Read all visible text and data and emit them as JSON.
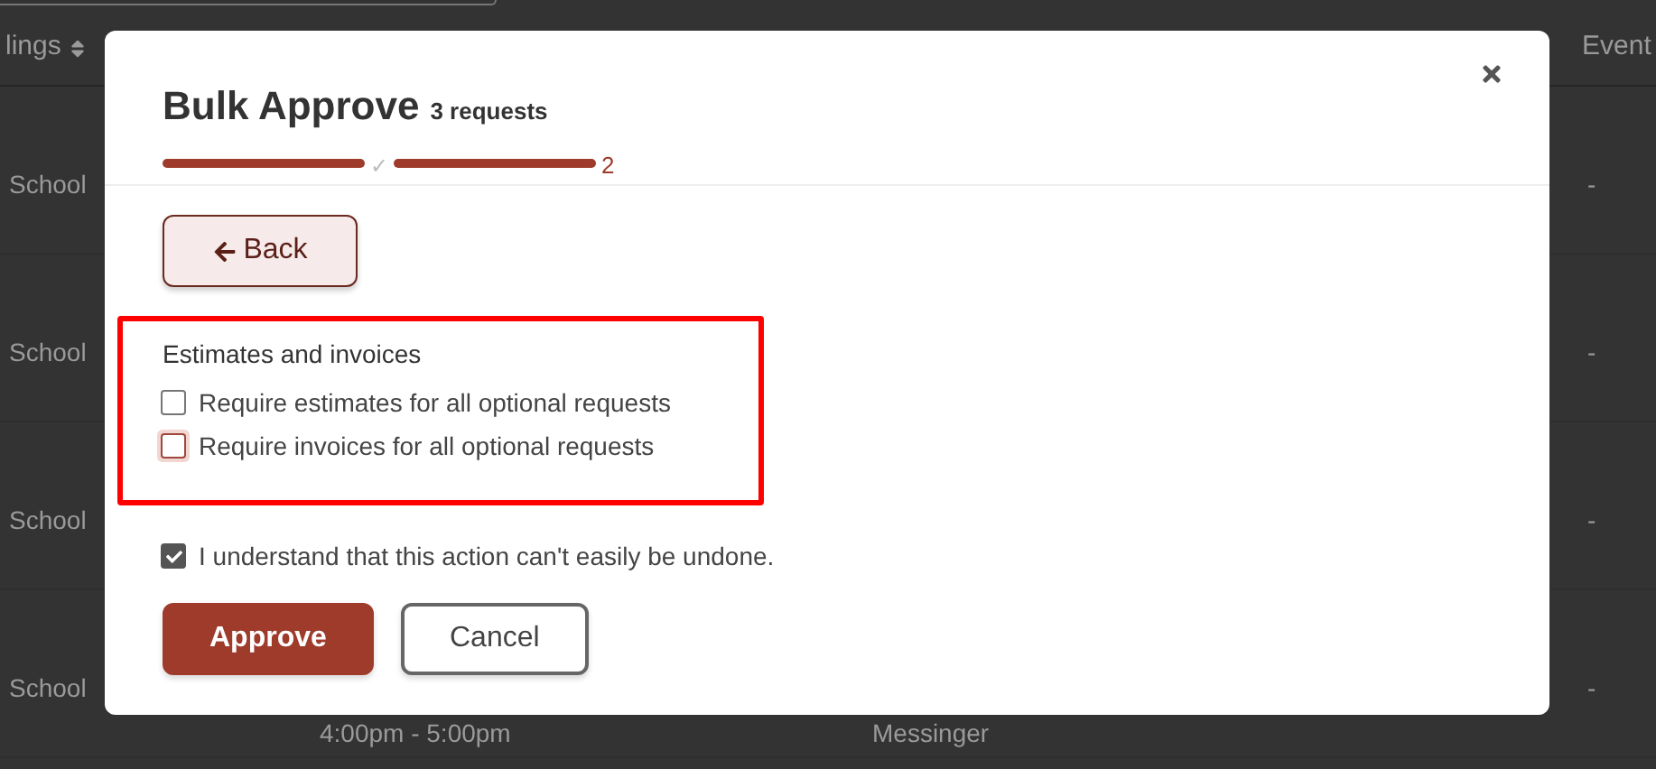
{
  "background_table": {
    "columns": [
      "lings",
      "Event"
    ],
    "rows": [
      {
        "column_1": "School",
        "event": "-"
      },
      {
        "column_1": "School",
        "event": "-"
      },
      {
        "column_1": "School",
        "event": "-"
      },
      {
        "column_1": "School",
        "column_2": "4:00pm - 5:00pm",
        "column_3": "Messinger",
        "event": "-"
      }
    ]
  },
  "dialog": {
    "title": "Bulk Approve",
    "subtitle": "3 requests",
    "progress": [
      {
        "level": 1,
        "marker": "✓",
        "current": false
      },
      {
        "level": 1,
        "marker": "2",
        "current": true
      }
    ],
    "back_button": "Back",
    "section": {
      "heading": "Estimates and invoices",
      "highlighted": true,
      "options": [
        {
          "label": "Require estimates for all optional requests",
          "checked": false,
          "focused": false
        },
        {
          "label": "Require invoices for all optional requests",
          "checked": false,
          "focused": true
        }
      ]
    },
    "confirm": {
      "label": "I understand that this action can't easily be undone.",
      "checked": true
    },
    "buttons": [
      {
        "label": "Approve",
        "kind": "primary"
      },
      {
        "label": "Cancel",
        "kind": "secondary"
      }
    ]
  }
}
